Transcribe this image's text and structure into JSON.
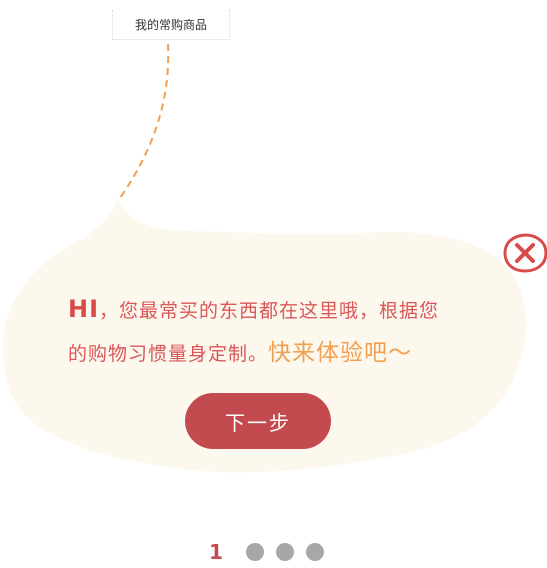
{
  "tab": {
    "label": "我的常购商品"
  },
  "bubble": {
    "hi": "HI",
    "sep": "，",
    "line1": "您最常买的东西都在这里哦，根据您",
    "line2": "的购物习惯量身定制。",
    "cta": "快来体验吧～"
  },
  "buttons": {
    "next": "下一步"
  },
  "pager": {
    "current": "1",
    "total_dots": 3
  },
  "colors": {
    "accent": "#c34a4f",
    "text_red": "#d95757",
    "cta_orange": "#f0a04e",
    "bubble_fill": "#fdf8ee",
    "dot_gray": "#a7a7a7"
  },
  "icons": {
    "close": "close-icon"
  }
}
